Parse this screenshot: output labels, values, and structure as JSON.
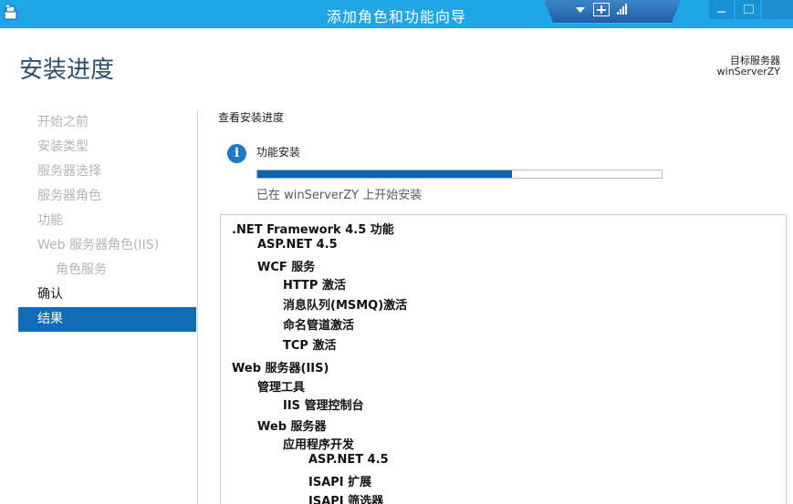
{
  "window": {
    "title": "添加角色和功能向导",
    "icon": "wizard-app-icon",
    "accent_color": "#1ea6e6"
  },
  "header": {
    "page_title": "安装进度",
    "target_server_label": "目标服务器",
    "target_server_name": "winServerZY"
  },
  "nav": {
    "items": [
      {
        "label": "开始之前",
        "state": "disabled"
      },
      {
        "label": "安装类型",
        "state": "disabled"
      },
      {
        "label": "服务器选择",
        "state": "disabled"
      },
      {
        "label": "服务器角色",
        "state": "disabled"
      },
      {
        "label": "功能",
        "state": "disabled"
      },
      {
        "label": "Web 服务器角色(IIS)",
        "state": "disabled"
      },
      {
        "label": "角色服务",
        "state": "disabled",
        "sub": true
      },
      {
        "label": "确认",
        "state": "normal"
      },
      {
        "label": "结果",
        "state": "active"
      }
    ]
  },
  "main": {
    "section_title": "查看安装进度",
    "status_icon": "info-icon",
    "status_title": "功能安装",
    "progress": 0.63,
    "status_text": "已在 winServerZY 上开始安装",
    "results": [
      {
        "label": ".NET Framework 4.5 功能",
        "level": 0
      },
      {
        "label": "ASP.NET 4.5",
        "level": 1
      },
      {
        "label": "WCF 服务",
        "level": 1
      },
      {
        "label": "HTTP 激活",
        "level": 2
      },
      {
        "label": "消息队列(MSMQ)激活",
        "level": 2
      },
      {
        "label": "命名管道激活",
        "level": 2
      },
      {
        "label": "TCP 激活",
        "level": 2
      },
      {
        "label": "Web 服务器(IIS)",
        "level": 0
      },
      {
        "label": "管理工具",
        "level": 1
      },
      {
        "label": "IIS 管理控制台",
        "level": 2
      },
      {
        "label": "Web 服务器",
        "level": 1
      },
      {
        "label": "应用程序开发",
        "level": 2
      },
      {
        "label": "ASP.NET 4.5",
        "level": 3
      },
      {
        "label": "ISAPI 扩展",
        "level": 3
      },
      {
        "label": "ISAPI 筛选器",
        "level": 3
      }
    ]
  }
}
